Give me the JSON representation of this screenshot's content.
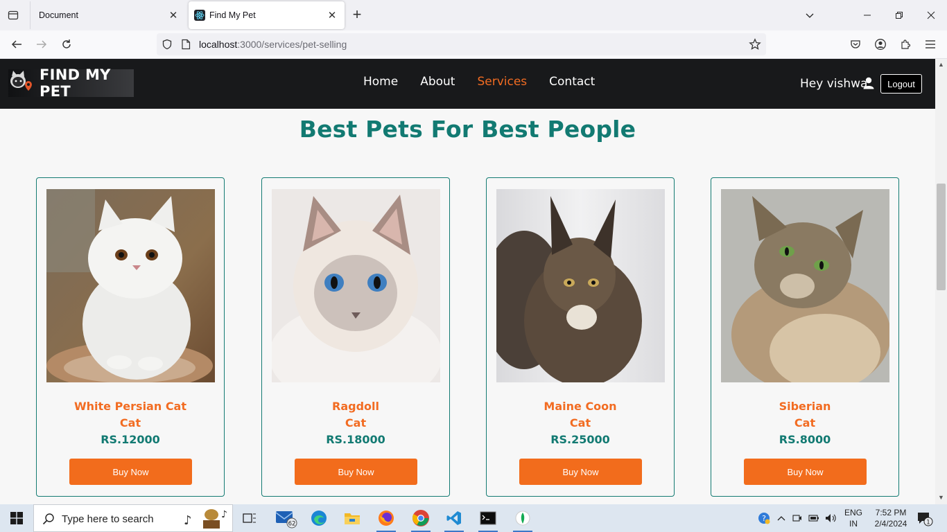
{
  "browser": {
    "tabs": [
      {
        "title": "Document",
        "active": false
      },
      {
        "title": "Find My Pet",
        "active": true
      }
    ],
    "url_host": "localhost",
    "url_rest": ":3000/services/pet-selling"
  },
  "site": {
    "logo_text": "FIND MY PET",
    "nav": [
      "Home",
      "About",
      "Services",
      "Contact"
    ],
    "active_nav": "Services",
    "greeting": "Hey vishwa",
    "logout_label": "Logout",
    "heading": "Best Pets For Best People",
    "accent_color": "#f26c22",
    "teal_color": "#127a72",
    "pets": [
      {
        "name": "White Persian Cat",
        "category": "Cat",
        "price": "RS.12000",
        "button": "Buy Now"
      },
      {
        "name": "Ragdoll",
        "category": "Cat",
        "price": "RS.18000",
        "button": "Buy Now"
      },
      {
        "name": "Maine Coon",
        "category": "Cat",
        "price": "RS.25000",
        "button": "Buy Now"
      },
      {
        "name": "Siberian",
        "category": "Cat",
        "price": "RS.8000",
        "button": "Buy Now"
      }
    ]
  },
  "taskbar": {
    "search_placeholder": "Type here to search",
    "mail_badge": "62",
    "lang_top": "ENG",
    "lang_bottom": "IN",
    "time": "7:52 PM",
    "date": "2/4/2024",
    "notification_count": "1"
  }
}
